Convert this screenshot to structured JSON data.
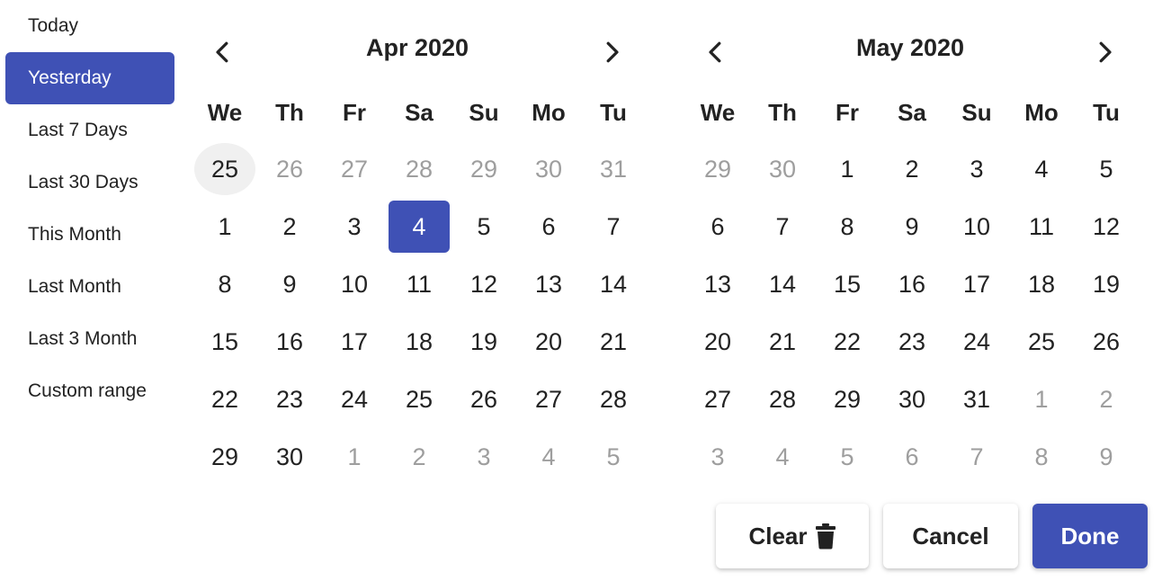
{
  "sidebar": {
    "items": [
      {
        "label": "Today",
        "active": false
      },
      {
        "label": "Yesterday",
        "active": true
      },
      {
        "label": "Last 7 Days",
        "active": false
      },
      {
        "label": "Last 30 Days",
        "active": false
      },
      {
        "label": "This Month",
        "active": false
      },
      {
        "label": "Last Month",
        "active": false
      },
      {
        "label": "Last 3 Month",
        "active": false
      },
      {
        "label": "Custom range",
        "active": false
      }
    ]
  },
  "calendars": [
    {
      "title": "Apr 2020",
      "weekdays": [
        "We",
        "Th",
        "Fr",
        "Sa",
        "Su",
        "Mo",
        "Tu"
      ],
      "days": [
        {
          "d": "25",
          "s": "today"
        },
        {
          "d": "26",
          "s": "outside"
        },
        {
          "d": "27",
          "s": "outside"
        },
        {
          "d": "28",
          "s": "outside"
        },
        {
          "d": "29",
          "s": "outside"
        },
        {
          "d": "30",
          "s": "outside"
        },
        {
          "d": "31",
          "s": "outside"
        },
        {
          "d": "1"
        },
        {
          "d": "2"
        },
        {
          "d": "3"
        },
        {
          "d": "4",
          "s": "selected"
        },
        {
          "d": "5"
        },
        {
          "d": "6"
        },
        {
          "d": "7"
        },
        {
          "d": "8"
        },
        {
          "d": "9"
        },
        {
          "d": "10"
        },
        {
          "d": "11"
        },
        {
          "d": "12"
        },
        {
          "d": "13"
        },
        {
          "d": "14"
        },
        {
          "d": "15"
        },
        {
          "d": "16"
        },
        {
          "d": "17"
        },
        {
          "d": "18"
        },
        {
          "d": "19"
        },
        {
          "d": "20"
        },
        {
          "d": "21"
        },
        {
          "d": "22"
        },
        {
          "d": "23"
        },
        {
          "d": "24"
        },
        {
          "d": "25"
        },
        {
          "d": "26"
        },
        {
          "d": "27"
        },
        {
          "d": "28"
        },
        {
          "d": "29"
        },
        {
          "d": "30"
        },
        {
          "d": "1",
          "s": "outside"
        },
        {
          "d": "2",
          "s": "outside"
        },
        {
          "d": "3",
          "s": "outside"
        },
        {
          "d": "4",
          "s": "outside"
        },
        {
          "d": "5",
          "s": "outside"
        }
      ]
    },
    {
      "title": "May 2020",
      "weekdays": [
        "We",
        "Th",
        "Fr",
        "Sa",
        "Su",
        "Mo",
        "Tu"
      ],
      "days": [
        {
          "d": "29",
          "s": "outside"
        },
        {
          "d": "30",
          "s": "outside"
        },
        {
          "d": "1"
        },
        {
          "d": "2"
        },
        {
          "d": "3"
        },
        {
          "d": "4"
        },
        {
          "d": "5"
        },
        {
          "d": "6"
        },
        {
          "d": "7"
        },
        {
          "d": "8"
        },
        {
          "d": "9"
        },
        {
          "d": "10"
        },
        {
          "d": "11"
        },
        {
          "d": "12"
        },
        {
          "d": "13"
        },
        {
          "d": "14"
        },
        {
          "d": "15"
        },
        {
          "d": "16"
        },
        {
          "d": "17"
        },
        {
          "d": "18"
        },
        {
          "d": "19"
        },
        {
          "d": "20"
        },
        {
          "d": "21"
        },
        {
          "d": "22"
        },
        {
          "d": "23"
        },
        {
          "d": "24"
        },
        {
          "d": "25"
        },
        {
          "d": "26"
        },
        {
          "d": "27"
        },
        {
          "d": "28"
        },
        {
          "d": "29"
        },
        {
          "d": "30"
        },
        {
          "d": "31"
        },
        {
          "d": "1",
          "s": "outside"
        },
        {
          "d": "2",
          "s": "outside"
        },
        {
          "d": "3",
          "s": "outside"
        },
        {
          "d": "4",
          "s": "outside"
        },
        {
          "d": "5",
          "s": "outside"
        },
        {
          "d": "6",
          "s": "outside"
        },
        {
          "d": "7",
          "s": "outside"
        },
        {
          "d": "8",
          "s": "outside"
        },
        {
          "d": "9",
          "s": "outside"
        }
      ]
    }
  ],
  "actions": {
    "clear_label": "Clear",
    "clear_icon": "trash-icon",
    "cancel_label": "Cancel",
    "done_label": "Done"
  },
  "colors": {
    "accent": "#3f51b5",
    "muted_text": "#9e9e9e",
    "today_bg": "#f0f0f0"
  }
}
